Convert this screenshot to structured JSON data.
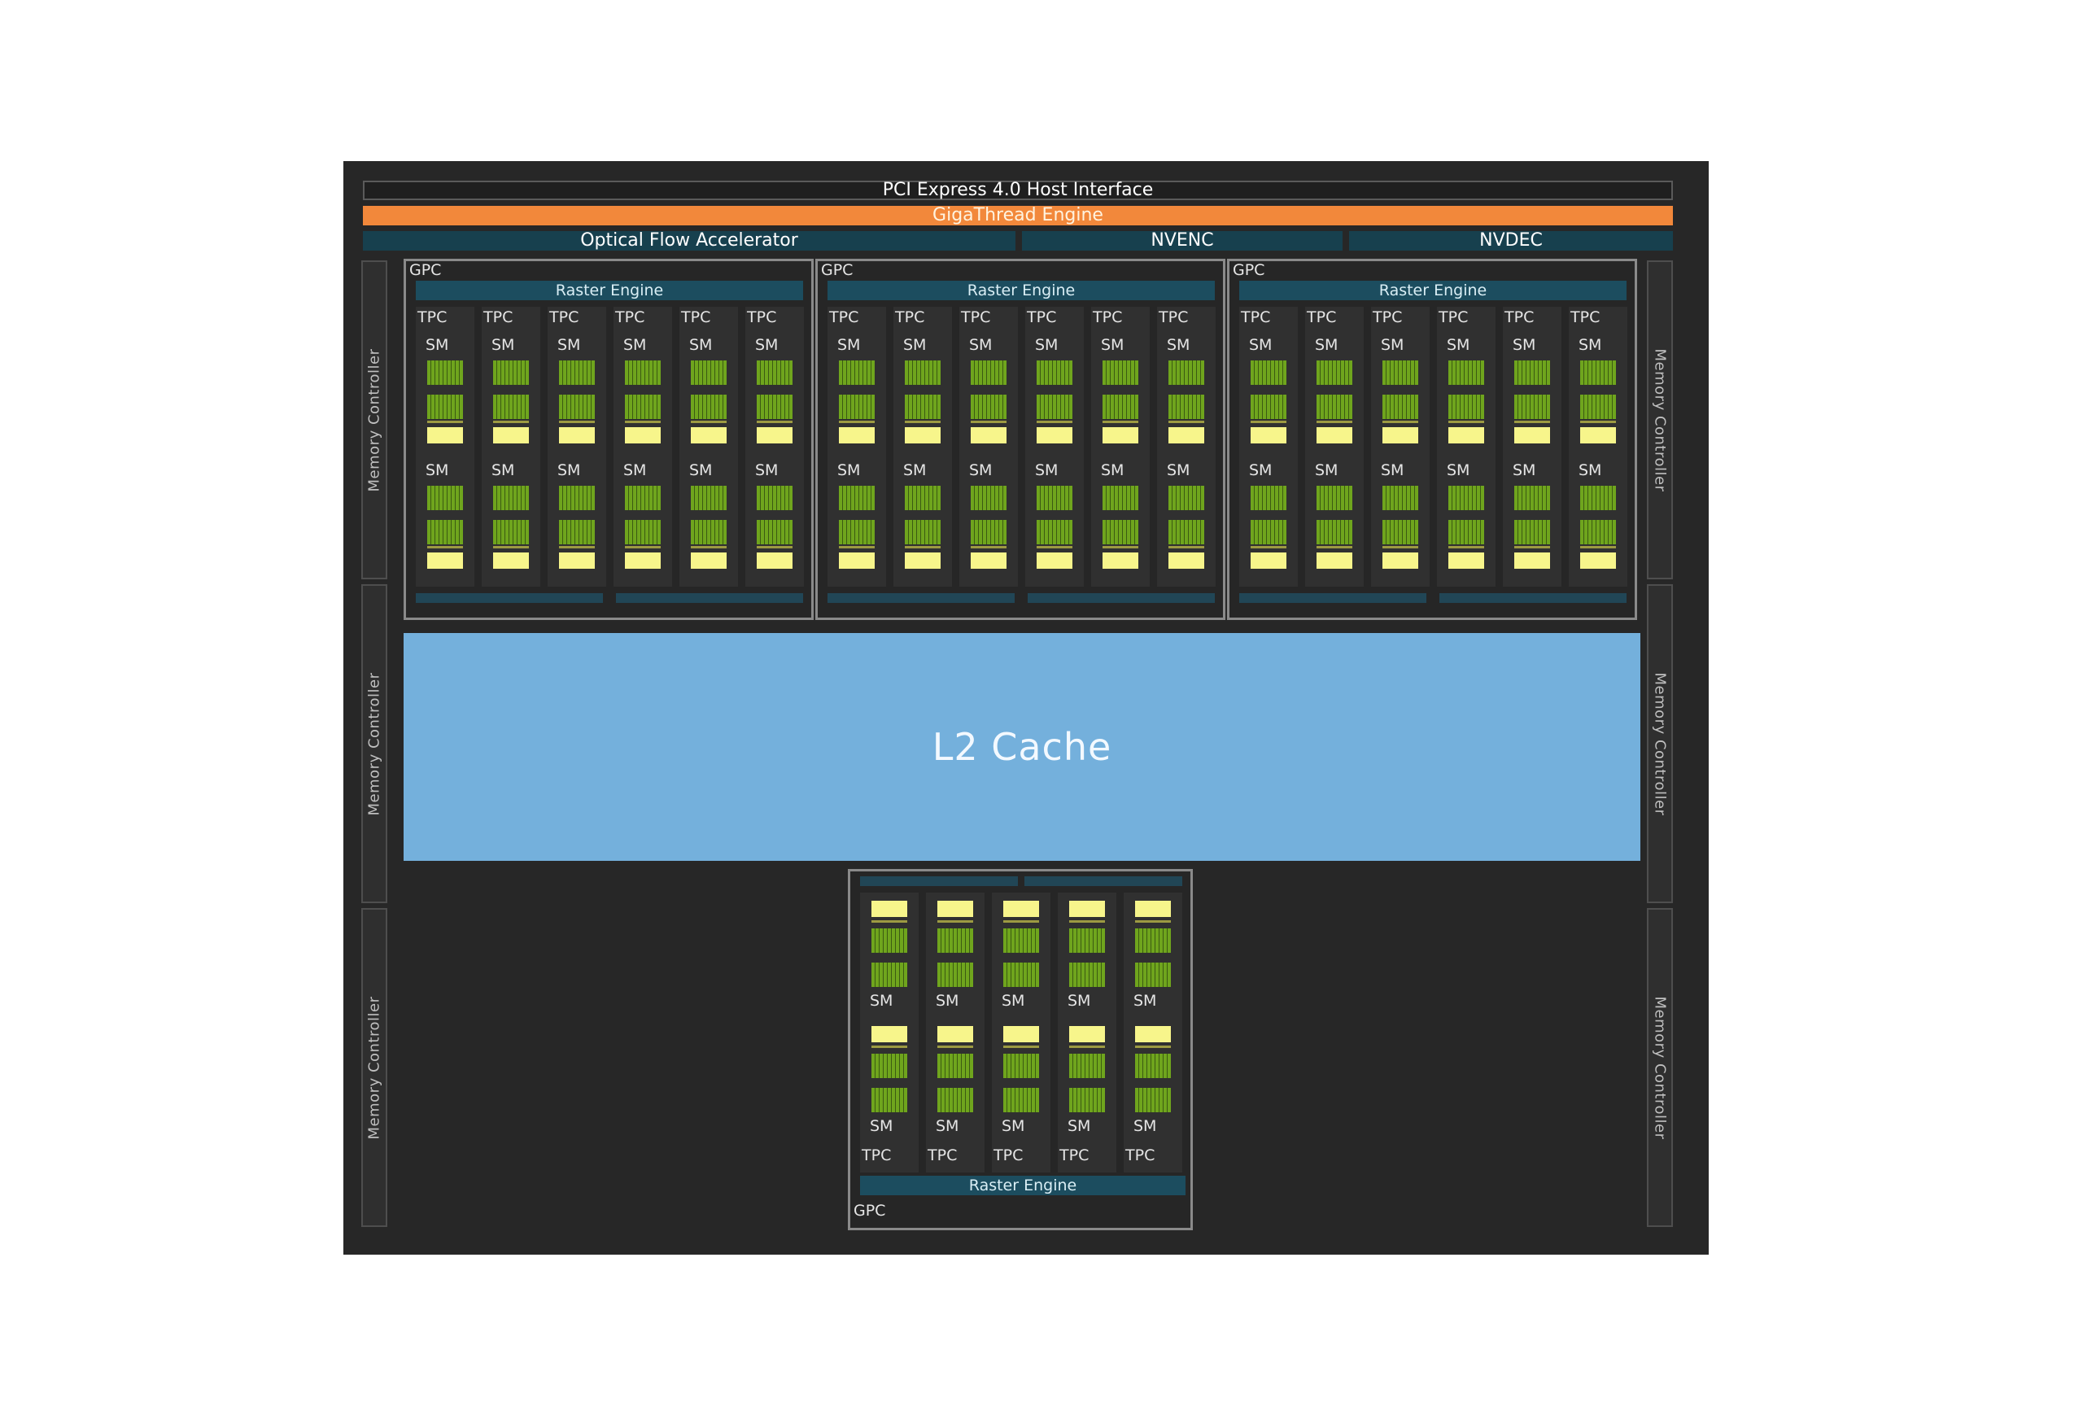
{
  "host_interface": "PCI Express 4.0 Host Interface",
  "gigathread": "GigaThread Engine",
  "ofa": "Optical Flow Accelerator",
  "nvenc": "NVENC",
  "nvdec": "NVDEC",
  "memory_controller": "Memory Controller",
  "gpc_label": "GPC",
  "raster_label": "Raster Engine",
  "tpc_label": "TPC",
  "sm_label": "SM",
  "l2_label": "L2 Cache",
  "colors": {
    "die": "#272727",
    "gigathread": "#f2883b",
    "engine_bar": "#17404e",
    "l2": "#74b0dc",
    "cuda_cores": "#6fa51d",
    "rt_core": "#f7f58b"
  },
  "structure": {
    "top_gpcs": 3,
    "tpcs_per_top_gpc": 6,
    "bottom_gpcs": 1,
    "tpcs_bottom_gpc": 5,
    "sms_per_tpc": 2,
    "memory_controllers": 6
  }
}
